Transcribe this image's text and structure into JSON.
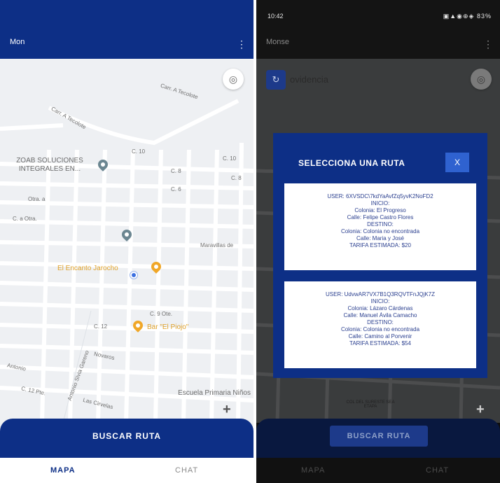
{
  "left": {
    "status": {
      "time": "",
      "icons": ""
    },
    "appbar": {
      "title": "Mon",
      "menu_icon": "more-vert-icon"
    },
    "map": {
      "streets": [
        "Carr. A Tecolote",
        "Carr. A Tecolote",
        "C. 10",
        "C. 10",
        "C. 8",
        "C. 8",
        "C. 6",
        "Otra. a",
        "C. a Otra.",
        "Maravillas de",
        "C. 9 Ote.",
        "C. 12",
        "Novaros",
        "Antonio",
        "C. 12 Pte.",
        "Las Cirvelas",
        "Antonio Slvia Gareno"
      ],
      "poi_business": "ZOAB SOLUCIONES INTEGRALES EN...",
      "poi_restaurant": "El Encanto Jarocho",
      "poi_bar": "Bar \"El Piojo\"",
      "poi_school": "Escuela Primaria Niños"
    },
    "bottom": {
      "button_label": "BUSCAR RUTA"
    },
    "tabs": {
      "mapa": "MAPA",
      "chat": "CHAT"
    }
  },
  "right": {
    "status": {
      "time": "10:42",
      "icons": "▣▲◉⊕◈ 83%"
    },
    "appbar": {
      "title": "Monse",
      "menu_icon": "more-vert-icon"
    },
    "search": {
      "text": "ovidencia"
    },
    "map": {
      "label": "COL DEL SURESTE SEA ETAPA"
    },
    "modal": {
      "title": "SELECCIONA UNA RUTA",
      "close_label": "X",
      "routes": [
        {
          "user": "USER: 6XVSDC\\7kdYaAvfZq5yvK2NoFD2",
          "inicio_label": "INICIO:",
          "inicio_colonia": "Colonia: El Progreso",
          "inicio_calle": "Calle: Felipe Castro Flores",
          "destino_label": "DESTINO:",
          "destino_colonia": "Colonia: Colonia no encontrada",
          "destino_calle": "Calle: Maria y José",
          "tarifa": "TARIFA ESTIMADA: $20"
        },
        {
          "user": "USER: UdvwAR7VX7B1Q3RQVTFnJQjK7Z",
          "inicio_label": "INICIO:",
          "inicio_colonia": "Colonia: Lázaro Cárdenas",
          "inicio_calle": "Calle: Manuel Ávila Camacho",
          "destino_label": "DESTINO:",
          "destino_colonia": "Colonia: Colonia no encontrada",
          "destino_calle": "Calle: Camino al Porvenir",
          "tarifa": "TARIFA ESTIMADA: $54"
        }
      ]
    },
    "bottom": {
      "button_label": "BUSCAR RUTA"
    },
    "tabs": {
      "mapa": "MAPA",
      "chat": "CHAT"
    }
  },
  "colors": {
    "brand": "#0d2f86",
    "accent": "#2f62d0",
    "poi_orange": "#f0a728",
    "poi_gray": "#6b8691"
  }
}
